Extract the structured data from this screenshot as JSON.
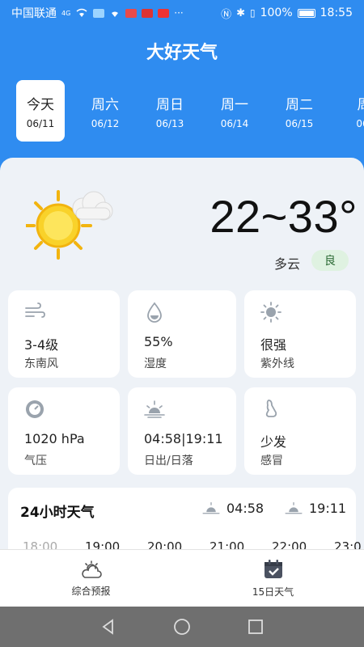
{
  "status_bar": {
    "carrier": "中国联通",
    "signal": "4G",
    "battery": "100%",
    "time": "18:55",
    "icons": [
      "signal-icon",
      "wifi-icon",
      "weather-icon",
      "app-notification-icon",
      "nfc-icon",
      "bluetooth-icon",
      "vibrate-icon",
      "battery-icon"
    ]
  },
  "header": {
    "title": "大好天气"
  },
  "days": [
    {
      "name": "今天",
      "date": "06/11"
    },
    {
      "name": "周六",
      "date": "06/12"
    },
    {
      "name": "周日",
      "date": "06/13"
    },
    {
      "name": "周一",
      "date": "06/14"
    },
    {
      "name": "周二",
      "date": "06/15"
    },
    {
      "name": "周",
      "date": "06/"
    }
  ],
  "today": {
    "icon": "partly-cloudy-icon",
    "temp": "22~33°",
    "condition": "多云",
    "aqi": "良"
  },
  "tiles": [
    {
      "icon": "wind-icon",
      "value": "3-4级",
      "label": "东南风"
    },
    {
      "icon": "humidity-icon",
      "value": "55%",
      "label": "湿度"
    },
    {
      "icon": "sun-icon",
      "value": "很强",
      "label": "紫外线"
    },
    {
      "icon": "pressure-icon",
      "value": "1020 hPa",
      "label": "气压"
    },
    {
      "icon": "sunrise-icon",
      "value": "04:58|19:11",
      "label": "日出/日落"
    },
    {
      "icon": "cold-icon",
      "value": "少发",
      "label": "感冒"
    }
  ],
  "hourly": {
    "title": "24小时天气",
    "sunrise": "04:58",
    "sunset": "19:11",
    "hours": [
      "18:00",
      "19:00",
      "20:00",
      "21:00",
      "22:00",
      "23:0"
    ]
  },
  "bottom_nav": [
    {
      "icon": "cloud-sun-icon",
      "label": "综合预报"
    },
    {
      "icon": "calendar-check-icon",
      "label": "15日天气"
    }
  ],
  "colors": {
    "accent": "#2f8cf0",
    "card_bg": "#eef2f7",
    "aqi_bg": "#dff2e1"
  }
}
